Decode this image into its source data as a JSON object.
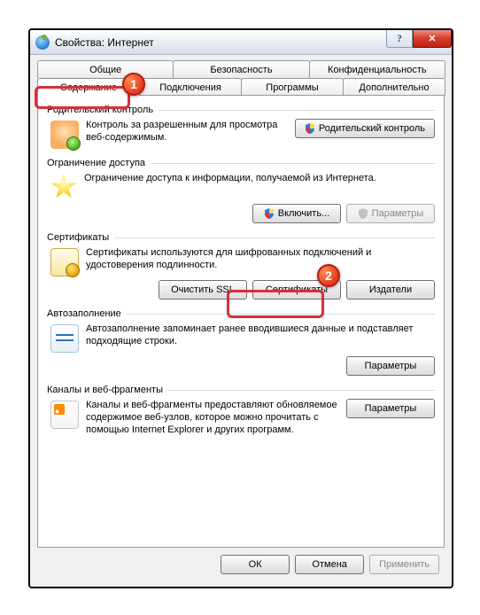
{
  "window": {
    "title": "Свойства: Интернет"
  },
  "tabs": {
    "row1": [
      "Общие",
      "Безопасность",
      "Конфиденциальность"
    ],
    "row2": [
      "Содержание",
      "Подключения",
      "Программы",
      "Дополнительно"
    ],
    "active": "Содержание"
  },
  "groups": {
    "parental": {
      "title": "Родительский контроль",
      "desc": "Контроль за разрешенным для просмотра веб-содержимым.",
      "button": "Родительский контроль"
    },
    "restrict": {
      "title": "Ограничение доступа",
      "desc": "Ограничение доступа к информации, получаемой из Интернета.",
      "enable_btn": "Включить...",
      "params_btn": "Параметры"
    },
    "certs": {
      "title": "Сертификаты",
      "desc": "Сертификаты используются для шифрованных подключений и удостоверения подлинности.",
      "clear_ssl": "Очистить SSL",
      "certs_btn": "Сертификаты",
      "publishers_btn": "Издатели"
    },
    "autofill": {
      "title": "Автозаполнение",
      "desc": "Автозаполнение запоминает ранее вводившиеся данные и подставляет подходящие строки.",
      "params_btn": "Параметры"
    },
    "feeds": {
      "title": "Каналы и веб-фрагменты",
      "desc": "Каналы и веб-фрагменты предоставляют обновляемое содержимое веб-узлов, которое можно прочитать с помощью Internet Explorer и других программ.",
      "params_btn": "Параметры"
    }
  },
  "buttons": {
    "ok": "ОК",
    "cancel": "Отмена",
    "apply": "Применить"
  },
  "callouts": {
    "one": "1",
    "two": "2"
  }
}
